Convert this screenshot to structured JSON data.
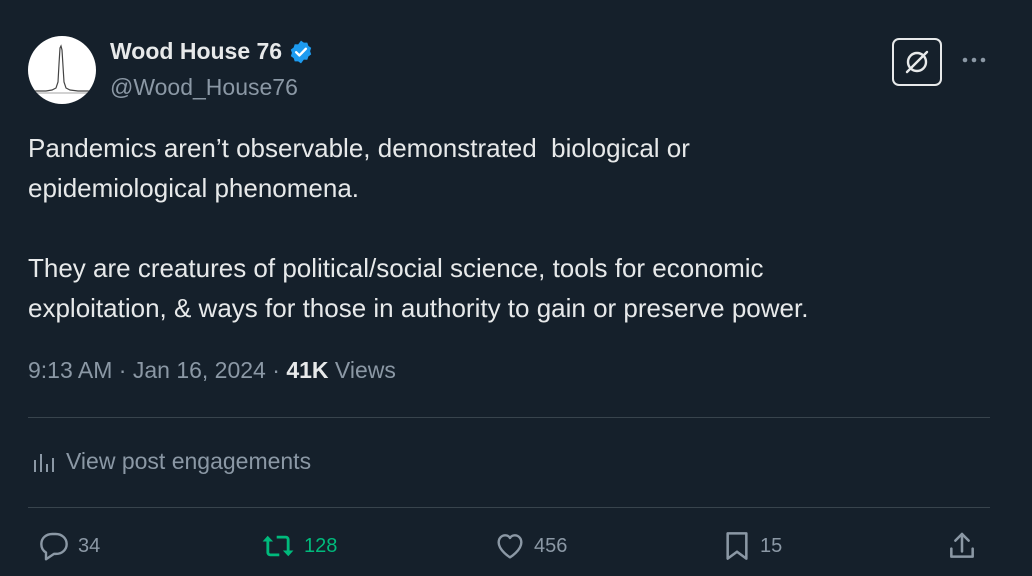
{
  "author": {
    "display_name": "Wood House 76",
    "handle": "@Wood_House76",
    "verified": true,
    "verified_color": "#1d9bf0",
    "avatar_icon": "peak-graph-avatar"
  },
  "tweet": {
    "text": "Pandemics aren’t observable, demonstrated  biological or\nepidemiological phenomena.\n\nThey are creatures of political/social science, tools for economic\nexploitation, & ways for those in authority to gain or preserve power.",
    "time": "9:13 AM",
    "date": "Jan 16, 2024",
    "separator": " · ",
    "views_count": "41K",
    "views_label": " Views"
  },
  "engagements_link": {
    "label": "View post engagements",
    "icon": "bar-chart-icon"
  },
  "actions": {
    "reply_count": "34",
    "repost_count": "128",
    "like_count": "456",
    "bookmark_count": "15",
    "repost_color": "#00ba7c"
  },
  "header_buttons": {
    "grok_icon": "grok-icon",
    "more_icon": "more-icon"
  },
  "colors": {
    "background": "#15202b",
    "primary_text": "#e7e9ea",
    "secondary_text": "#8b98a5",
    "divider": "#38444d"
  }
}
